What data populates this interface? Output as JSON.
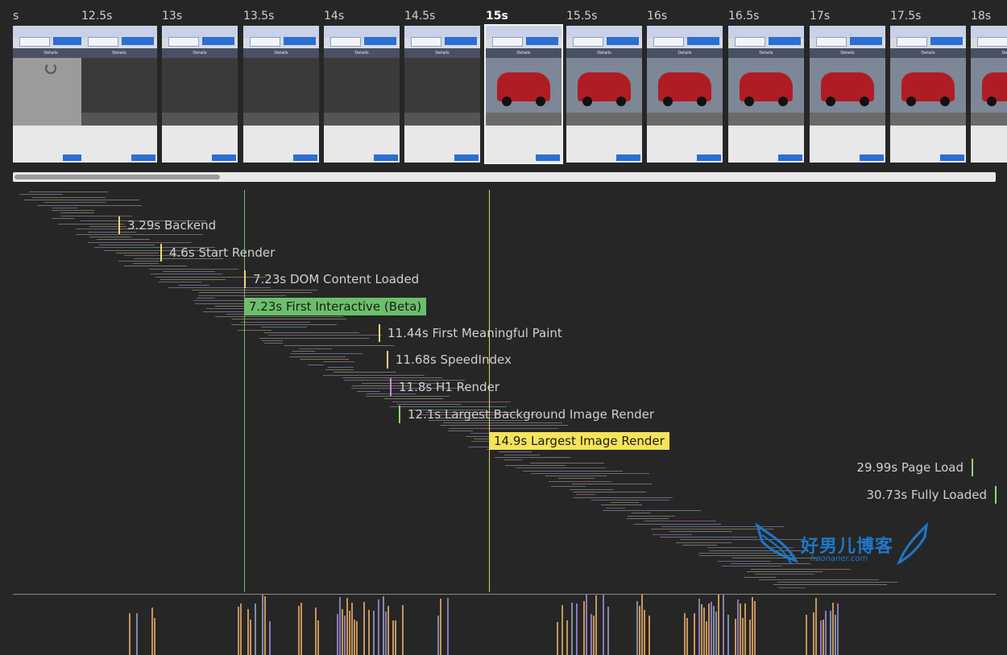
{
  "filmstrip": {
    "frames": [
      {
        "time": "s",
        "state": "loading"
      },
      {
        "time": "12.5s",
        "state": "dark"
      },
      {
        "time": "13s",
        "state": "dark"
      },
      {
        "time": "13.5s",
        "state": "dark"
      },
      {
        "time": "14s",
        "state": "dark"
      },
      {
        "time": "14.5s",
        "state": "dark"
      },
      {
        "time": "15s",
        "state": "image",
        "highlight": true
      },
      {
        "time": "15.5s",
        "state": "image"
      },
      {
        "time": "16s",
        "state": "image"
      },
      {
        "time": "16.5s",
        "state": "image"
      },
      {
        "time": "17s",
        "state": "image"
      },
      {
        "time": "17.5s",
        "state": "image"
      },
      {
        "time": "18s",
        "state": "image"
      }
    ],
    "thumb_nav_label": "Details"
  },
  "scrollbar": {
    "thumb_fraction": 0.21
  },
  "markers": [
    {
      "label": "3.29s Backend",
      "color": "#f0d878",
      "boxed": false
    },
    {
      "label": "4.6s Start Render",
      "color": "#f0d878",
      "boxed": false
    },
    {
      "label": "7.23s DOM Content Loaded",
      "color": "#f0d878",
      "boxed": false
    },
    {
      "label": "7.23s First Interactive (Beta)",
      "color": "#6bbf6b",
      "boxed": true,
      "text_color": "#1a1a1a"
    },
    {
      "label": "11.44s First Meaningful Paint",
      "color": "#f0d878",
      "boxed": false
    },
    {
      "label": "11.68s SpeedIndex",
      "color": "#f0d878",
      "boxed": false
    },
    {
      "label": "11.8s H1 Render",
      "color": "#c78ad6",
      "boxed": false
    },
    {
      "label": "12.1s Largest Background Image Render",
      "color": "#8fd67a",
      "boxed": false
    },
    {
      "label": "14.9s Largest Image Render",
      "color": "#f7e35a",
      "boxed": true,
      "text_color": "#1a1a1a"
    },
    {
      "label": "29.99s Page Load",
      "color": "#8fd67a",
      "boxed": false,
      "align": "right"
    },
    {
      "label": "30.73s Fully Loaded",
      "color": "#8fd67a",
      "boxed": false,
      "align": "right"
    }
  ],
  "colors": {
    "background": "#262626",
    "interactive_line": "#6bbf6b",
    "image_render_line": "#f7e35a",
    "cpu_script": "#c7955a",
    "cpu_layout": "#8a7ab8",
    "cpu_other": "#7d8ea5"
  },
  "watermark": {
    "text": "好男儿博客",
    "sub": "haonaner.com"
  }
}
